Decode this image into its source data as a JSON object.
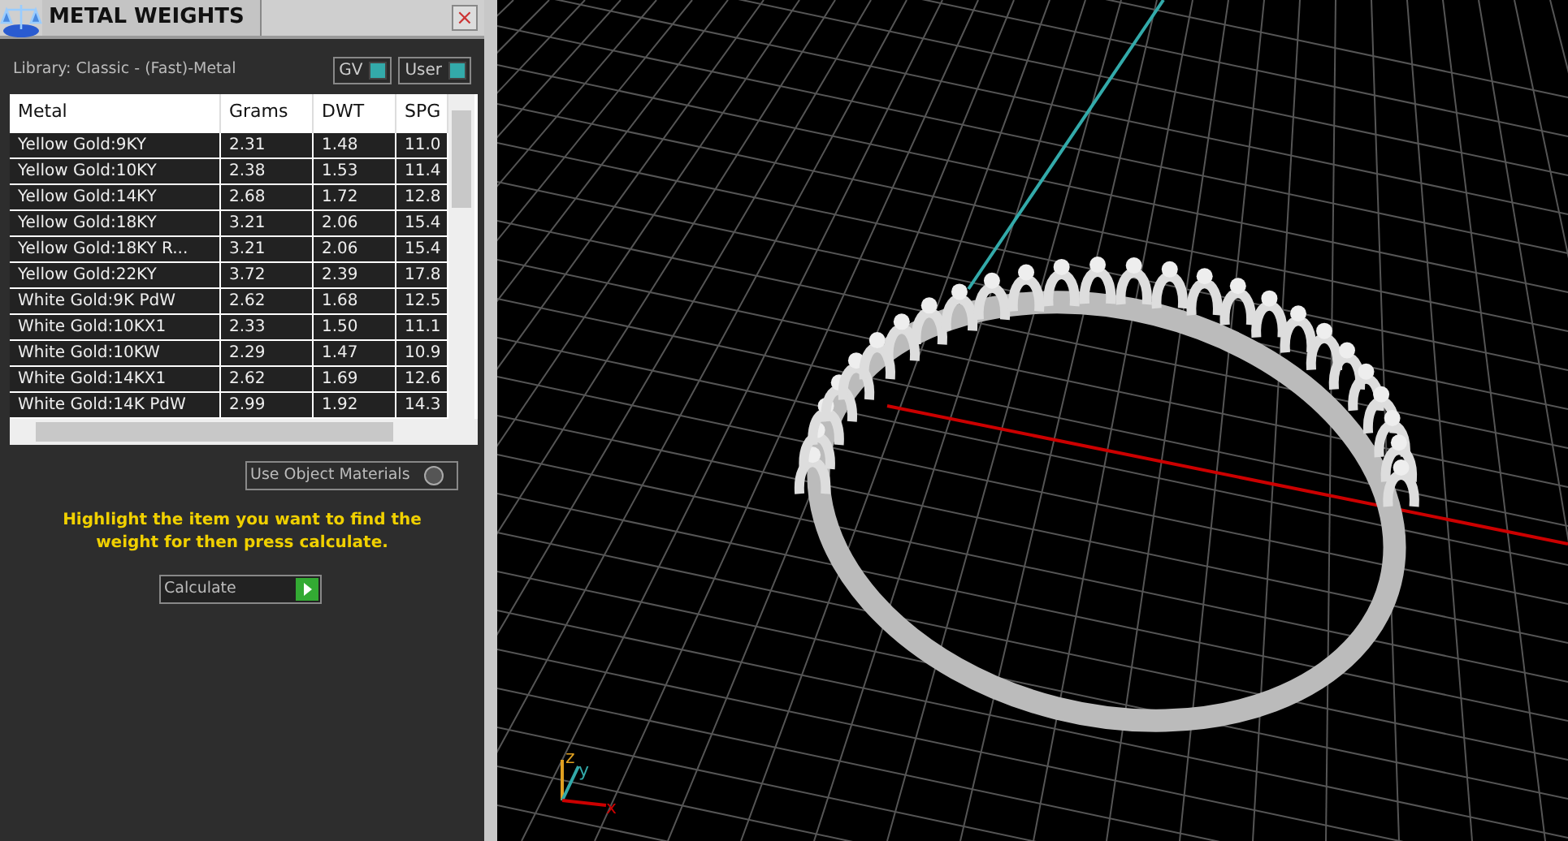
{
  "panel": {
    "title": "METAL WEIGHTS",
    "close": "×",
    "library": "Library: Classic - (Fast)-Metal",
    "toggles": [
      {
        "label": "GV",
        "on": true
      },
      {
        "label": "User",
        "on": true
      }
    ],
    "table": {
      "columns": [
        "Metal",
        "Grams",
        "DWT",
        "SPG"
      ],
      "rows": [
        [
          "Yellow Gold:9KY",
          "2.31",
          "1.48",
          "11.0"
        ],
        [
          "Yellow Gold:10KY",
          "2.38",
          "1.53",
          "11.4"
        ],
        [
          "Yellow Gold:14KY",
          "2.68",
          "1.72",
          "12.8"
        ],
        [
          "Yellow Gold:18KY",
          "3.21",
          "2.06",
          "15.4"
        ],
        [
          "Yellow Gold:18KY R...",
          "3.21",
          "2.06",
          "15.4"
        ],
        [
          "Yellow Gold:22KY",
          "3.72",
          "2.39",
          "17.8"
        ],
        [
          "White Gold:9K PdW",
          "2.62",
          "1.68",
          "12.5"
        ],
        [
          "White Gold:10KX1",
          "2.33",
          "1.50",
          "11.1"
        ],
        [
          "White Gold:10KW",
          "2.29",
          "1.47",
          "10.9"
        ],
        [
          "White Gold:14KX1",
          "2.62",
          "1.69",
          "12.6"
        ],
        [
          "White Gold:14K PdW",
          "2.99",
          "1.92",
          "14.3"
        ]
      ]
    },
    "use_object_materials": {
      "label": "Use Object Materials",
      "checked": false
    },
    "hint": "Highlight the item you want to find the weight for then press calculate.",
    "calculate": "Calculate"
  },
  "viewport": {
    "axes": {
      "z": "z",
      "y": "y",
      "x": "x"
    }
  }
}
